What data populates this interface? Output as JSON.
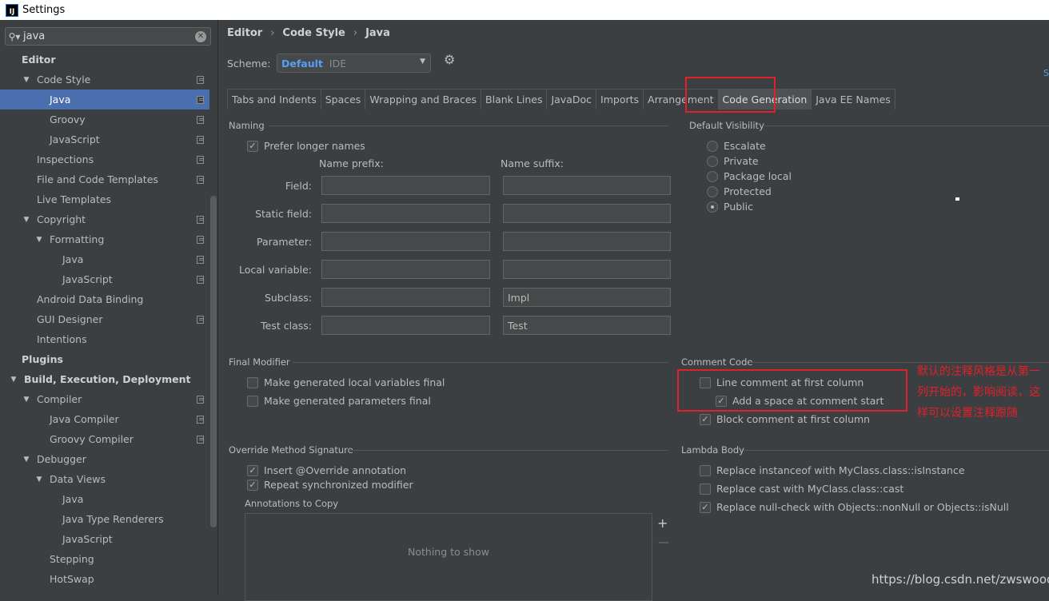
{
  "window": {
    "title": "Settings",
    "logo": "IJ"
  },
  "search": {
    "value": "java",
    "icon": "search-icon",
    "clear_icon": "clear-icon"
  },
  "tree": [
    {
      "label": "Editor",
      "level": 0,
      "bold": true,
      "arrow": "",
      "copy": false
    },
    {
      "label": "Code Style",
      "level": 1,
      "arrow": "▼",
      "copy": true
    },
    {
      "label": "Java",
      "level": 2,
      "arrow": "",
      "copy": true,
      "selected": true
    },
    {
      "label": "Groovy",
      "level": 2,
      "arrow": "",
      "copy": true
    },
    {
      "label": "JavaScript",
      "level": 2,
      "arrow": "",
      "copy": true
    },
    {
      "label": "Inspections",
      "level": 1,
      "arrow": "",
      "copy": true
    },
    {
      "label": "File and Code Templates",
      "level": 1,
      "arrow": "",
      "copy": true
    },
    {
      "label": "Live Templates",
      "level": 1,
      "arrow": "",
      "copy": false
    },
    {
      "label": "Copyright",
      "level": 1,
      "arrow": "▼",
      "copy": true
    },
    {
      "label": "Formatting",
      "level": 2,
      "arrow": "▼",
      "copy": true
    },
    {
      "label": "Java",
      "level": 3,
      "arrow": "",
      "copy": true
    },
    {
      "label": "JavaScript",
      "level": 3,
      "arrow": "",
      "copy": true
    },
    {
      "label": "Android Data Binding",
      "level": 1,
      "arrow": "",
      "copy": false
    },
    {
      "label": "GUI Designer",
      "level": 1,
      "arrow": "",
      "copy": true
    },
    {
      "label": "Intentions",
      "level": 1,
      "arrow": "",
      "copy": false
    },
    {
      "label": "Plugins",
      "level": 0,
      "bold": true,
      "arrow": "",
      "copy": false
    },
    {
      "label": "Build, Execution, Deployment",
      "level": 0,
      "bold": true,
      "arrow": "▼",
      "copy": false
    },
    {
      "label": "Compiler",
      "level": 1,
      "arrow": "▼",
      "copy": true
    },
    {
      "label": "Java Compiler",
      "level": 2,
      "arrow": "",
      "copy": true
    },
    {
      "label": "Groovy Compiler",
      "level": 2,
      "arrow": "",
      "copy": true
    },
    {
      "label": "Debugger",
      "level": 1,
      "arrow": "▼",
      "copy": false
    },
    {
      "label": "Data Views",
      "level": 2,
      "arrow": "▼",
      "copy": false
    },
    {
      "label": "Java",
      "level": 3,
      "arrow": "",
      "copy": false
    },
    {
      "label": "Java Type Renderers",
      "level": 3,
      "arrow": "",
      "copy": false
    },
    {
      "label": "JavaScript",
      "level": 3,
      "arrow": "",
      "copy": false
    },
    {
      "label": "Stepping",
      "level": 2,
      "arrow": "",
      "copy": false
    },
    {
      "label": "HotSwap",
      "level": 2,
      "arrow": "",
      "copy": false
    }
  ],
  "breadcrumb": {
    "a": "Editor",
    "b": "Code Style",
    "c": "Java",
    "sep": "›"
  },
  "scheme": {
    "label": "Scheme:",
    "name": "Default",
    "kind": "IDE"
  },
  "side_link": "S",
  "tabs": [
    "Tabs and Indents",
    "Spaces",
    "Wrapping and Braces",
    "Blank Lines",
    "JavaDoc",
    "Imports",
    "Arrangement",
    "Code Generation",
    "Java EE Names"
  ],
  "active_tab": "Code Generation",
  "naming": {
    "title": "Naming",
    "prefer_longer": "Prefer longer names",
    "prefix_header": "Name prefix:",
    "suffix_header": "Name suffix:",
    "rows": [
      {
        "label": "Field:",
        "prefix": "",
        "suffix": ""
      },
      {
        "label": "Static field:",
        "prefix": "",
        "suffix": ""
      },
      {
        "label": "Parameter:",
        "prefix": "",
        "suffix": ""
      },
      {
        "label": "Local variable:",
        "prefix": "",
        "suffix": ""
      },
      {
        "label": "Subclass:",
        "prefix": "",
        "suffix": "Impl"
      },
      {
        "label": "Test class:",
        "prefix": "",
        "suffix": "Test"
      }
    ]
  },
  "visibility": {
    "title": "Default Visibility",
    "options": [
      {
        "label": "Escalate",
        "checked": false
      },
      {
        "label": "Private",
        "checked": false
      },
      {
        "label": "Package local",
        "checked": false
      },
      {
        "label": "Protected",
        "checked": false
      },
      {
        "label": "Public",
        "checked": true
      }
    ]
  },
  "final_modifier": {
    "title": "Final Modifier",
    "opt1": "Make generated local variables final",
    "opt2": "Make generated parameters final"
  },
  "comment_code": {
    "title": "Comment Code",
    "line_first": "Line comment at first column",
    "add_space": "Add a space at comment start",
    "block_first": "Block comment at first column"
  },
  "override": {
    "title": "Override Method Signature",
    "insert": "Insert @Override annotation",
    "repeat": "Repeat synchronized modifier",
    "annotations": "Annotations to Copy",
    "empty": "Nothing to show"
  },
  "lambda": {
    "title": "Lambda Body",
    "opt1": "Replace instanceof with MyClass.class::isInstance",
    "opt2": "Replace cast with MyClass.class::cast",
    "opt3": "Replace null-check with Objects::nonNull or Objects::isNull"
  },
  "annotation_note": "默认的注释风格是从第一列开始的，影响阅读，这样可以设置注释跟随",
  "watermark": "https://blog.csdn.net/zwswood",
  "colors": {
    "highlight": "#e0202a",
    "selection": "#4b6eaf",
    "link": "#589df6"
  }
}
